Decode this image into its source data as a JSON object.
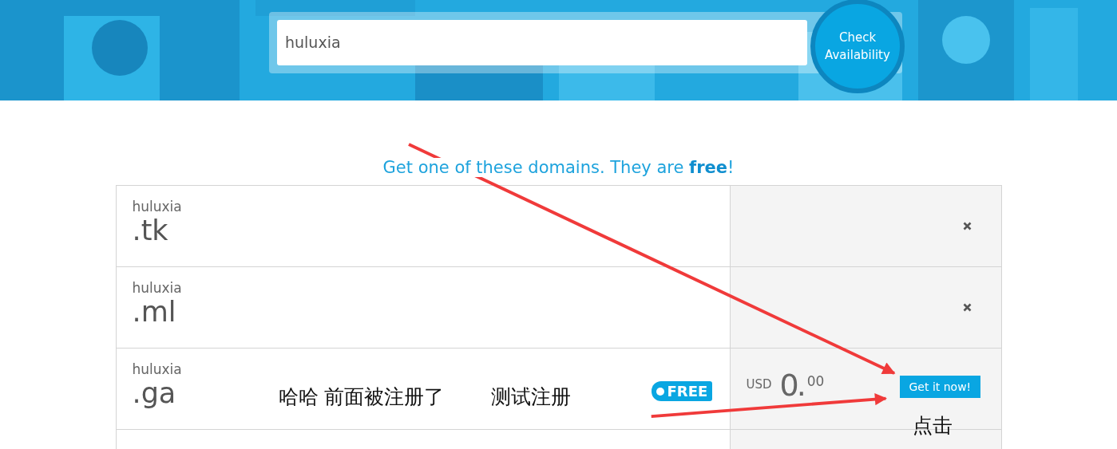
{
  "search": {
    "value": "huluxia",
    "button": "Check Availability"
  },
  "heading": "Get one of these domains. They are **free**!",
  "domains": [
    {
      "kind": "taken",
      "name": "huluxia",
      "tld": ".tk"
    },
    {
      "kind": "taken",
      "name": "huluxia",
      "tld": ".ml"
    },
    {
      "kind": "free",
      "name": "huluxia",
      "tld": ".ga",
      "badge": "FREE",
      "currency": "USD",
      "price": "0.",
      "cents": "00",
      "button": "Get it now!"
    },
    {
      "kind": "partial"
    }
  ],
  "annotations": [
    "哈哈 前面被注册了",
    "测试注册",
    "点击"
  ]
}
